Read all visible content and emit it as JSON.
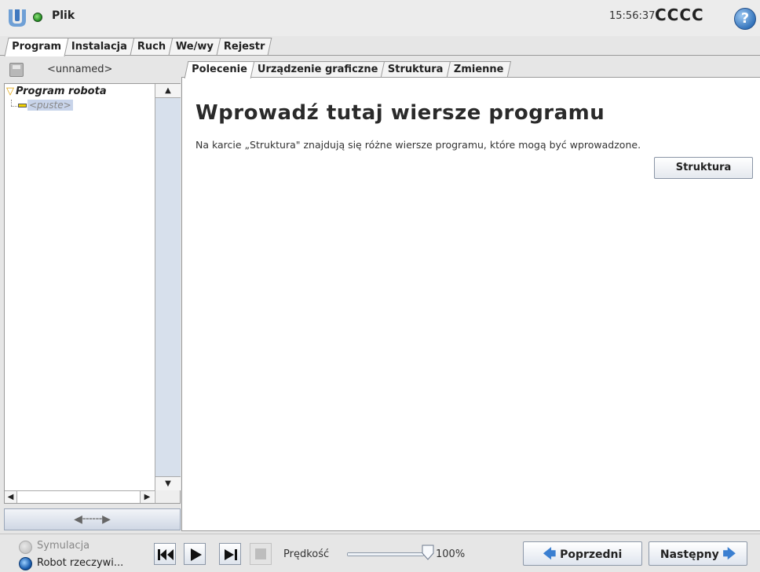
{
  "colors": {
    "accent": "#3a7fd1",
    "status_dot": "#1e8a1e",
    "tree_highlight": "#c8d4ea",
    "scroll_track": "#d7e0ec"
  },
  "header": {
    "file_menu": "Plik",
    "clock": "15:56:37",
    "robot_name": "CCCC",
    "help_icon": "?"
  },
  "main_tabs": [
    {
      "label": "Program",
      "active": true
    },
    {
      "label": "Instalacja",
      "active": false
    },
    {
      "label": "Ruch",
      "active": false
    },
    {
      "label": "We/wy",
      "active": false
    },
    {
      "label": "Rejestr",
      "active": false
    }
  ],
  "left_panel": {
    "program_name": "<unnamed>",
    "tree_root": "Program robota",
    "tree_child": "<puste>"
  },
  "sub_tabs": [
    {
      "label": "Polecenie",
      "active": true
    },
    {
      "label": "Urządzenie graficzne",
      "active": false
    },
    {
      "label": "Struktura",
      "active": false
    },
    {
      "label": "Zmienne",
      "active": false
    }
  ],
  "content": {
    "heading": "Wprowadź tutaj wiersze programu",
    "description": "Na karcie „Struktura\" znajdują się różne wiersze programu, które mogą być wprowadzone.",
    "struktura_button": "Struktura"
  },
  "footer": {
    "sim_label": "Symulacja",
    "real_label": "Robot rzeczywi...",
    "speed_label": "Prędkość",
    "speed_value": "100%",
    "speed_fraction": 1.0,
    "prev_label": "Poprzedni",
    "next_label": "Następny"
  },
  "icons": {
    "logo": "ur-logo-icon",
    "status": "status-dot-icon",
    "help": "help-icon",
    "rewind": "rewind-icon",
    "play": "play-icon",
    "step": "step-icon",
    "stop": "stop-icon",
    "prev": "arrow-left-icon",
    "next": "arrow-right-icon"
  }
}
